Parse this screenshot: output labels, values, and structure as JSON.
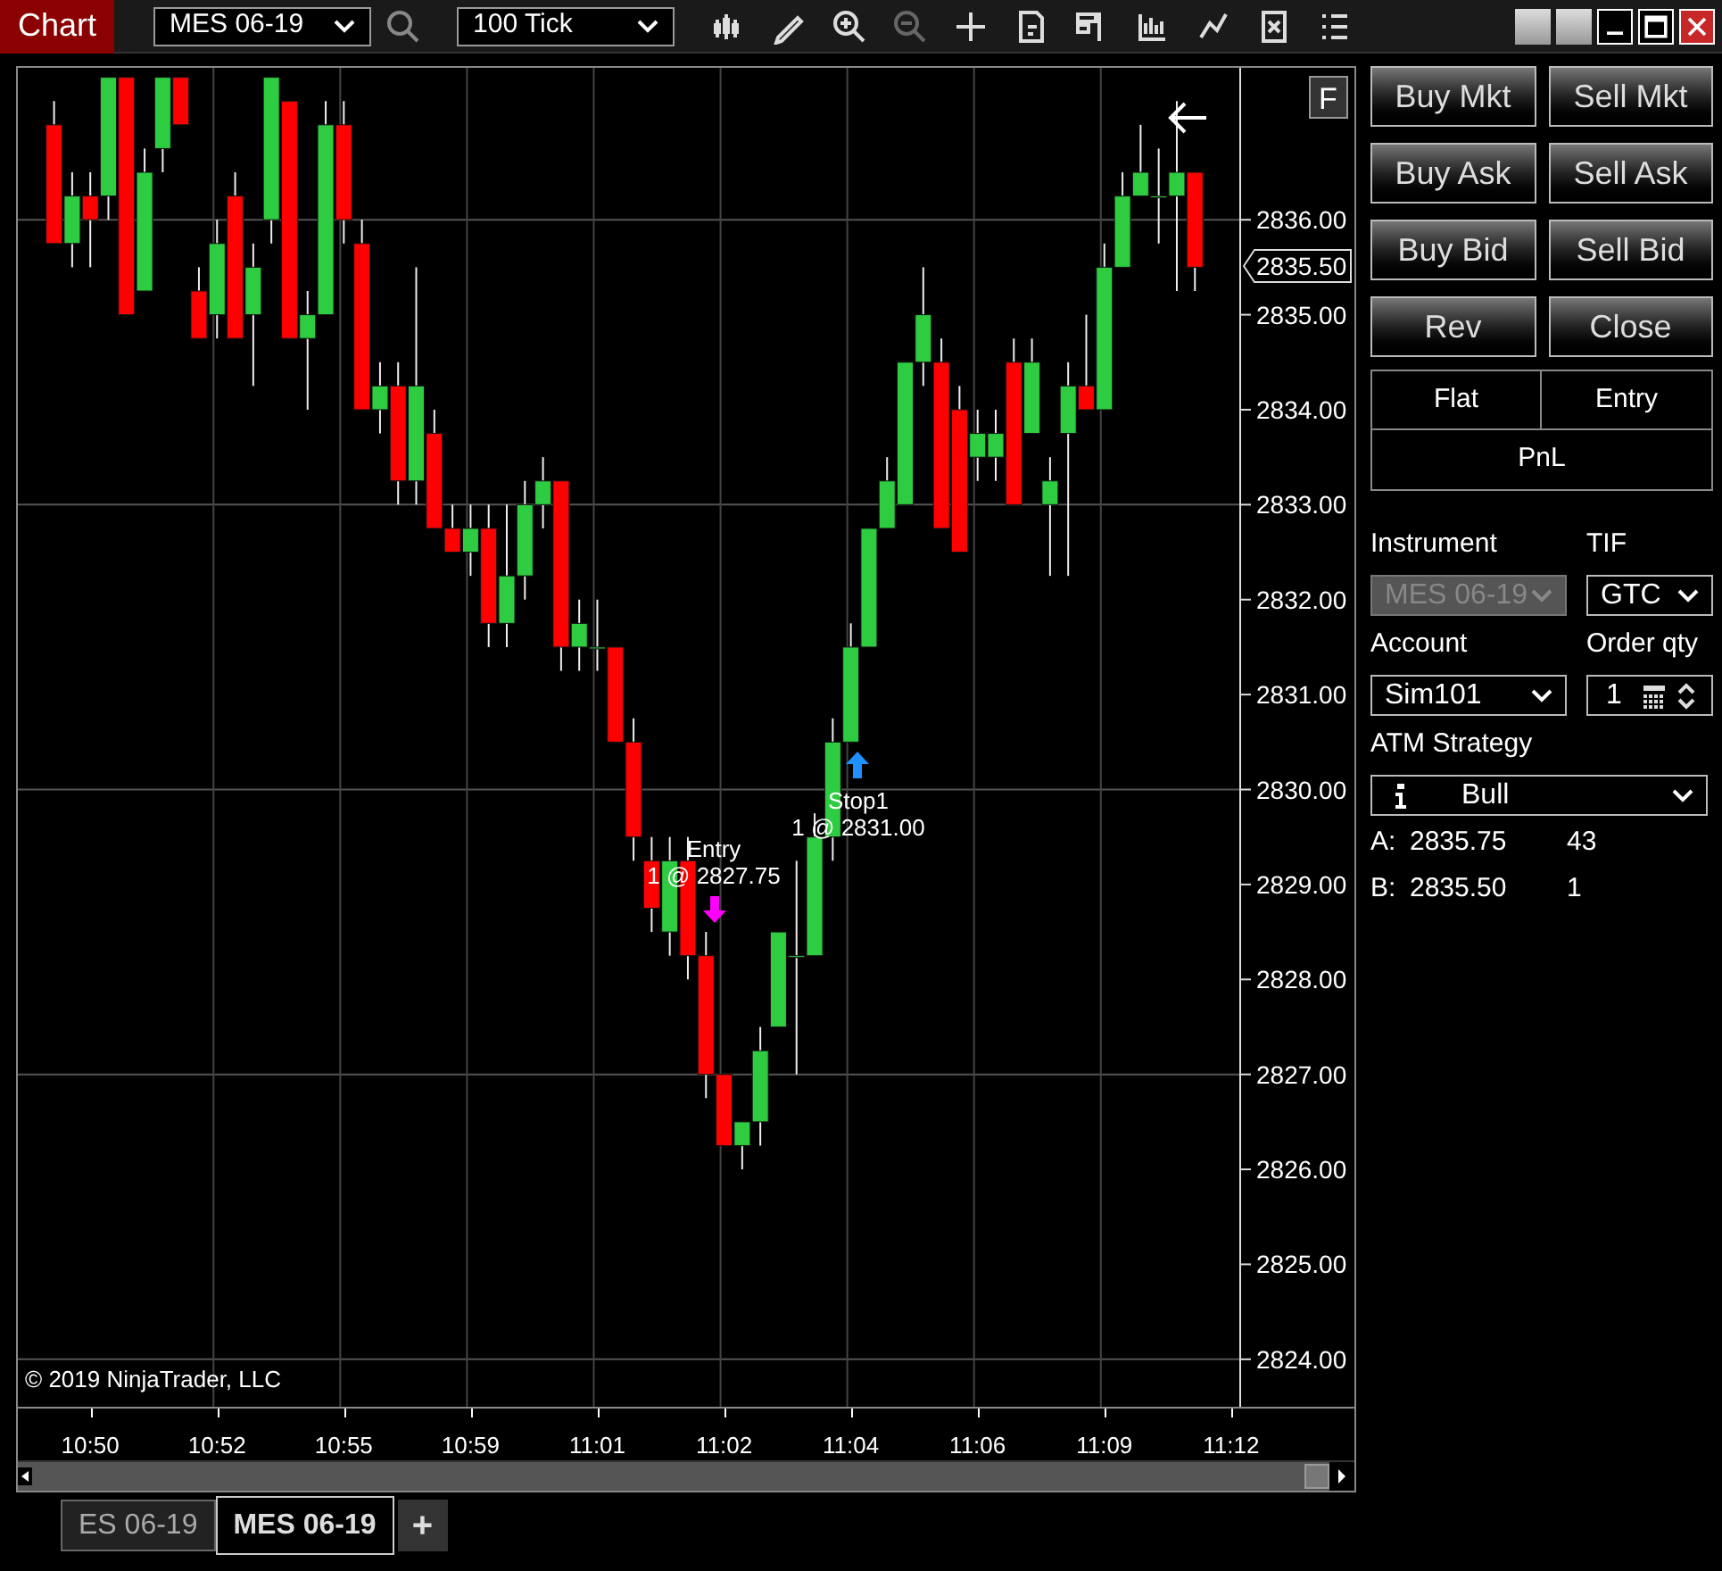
{
  "window": {
    "title": "Chart",
    "instrument": "MES 06-19",
    "interval": "100 Tick"
  },
  "chart": {
    "chart_data": {
      "type": "candlestick",
      "grid": true,
      "ylim": [
        2823.5,
        2837.6
      ],
      "categories": [
        null,
        null,
        "10:50",
        null,
        null,
        null,
        null,
        null,
        null,
        "10:52",
        null,
        null,
        null,
        null,
        null,
        null,
        "10:55",
        null,
        null,
        null,
        null,
        null,
        null,
        "10:59",
        null,
        null,
        null,
        null,
        null,
        null,
        "11:01",
        null,
        null,
        null,
        null,
        null,
        null,
        "11:02",
        null,
        null,
        null,
        null,
        null,
        null,
        "11:04",
        null,
        null,
        null,
        null,
        null,
        null,
        "11:06",
        null,
        null,
        null,
        null,
        null,
        null,
        "11:09",
        null,
        null,
        null,
        null,
        null
      ],
      "ohlc": [
        [
          2837.0,
          2837.25,
          2835.75,
          2835.75
        ],
        [
          2835.75,
          2836.5,
          2835.5,
          2836.25
        ],
        [
          2836.25,
          2836.5,
          2835.5,
          2836.0
        ],
        [
          2836.25,
          2837.5,
          2836.0,
          2837.5
        ],
        [
          2837.5,
          2837.5,
          2835.0,
          2835.0
        ],
        [
          2835.25,
          2836.75,
          2835.25,
          2836.5
        ],
        [
          2836.75,
          2837.5,
          2836.5,
          2837.5
        ],
        [
          2837.5,
          2837.5,
          2837.0,
          2837.0
        ],
        [
          2835.25,
          2835.5,
          2834.75,
          2834.75
        ],
        [
          2835.0,
          2836.0,
          2834.75,
          2835.75
        ],
        [
          2836.25,
          2836.5,
          2834.75,
          2834.75
        ],
        [
          2835.0,
          2835.75,
          2834.25,
          2835.5
        ],
        [
          2836.0,
          2837.5,
          2835.75,
          2837.5
        ],
        [
          2837.25,
          2837.25,
          2834.75,
          2834.75
        ],
        [
          2834.75,
          2835.25,
          2834.0,
          2835.0
        ],
        [
          2835.0,
          2837.25,
          2835.0,
          2837.0
        ],
        [
          2837.0,
          2837.25,
          2835.75,
          2836.0
        ],
        [
          2835.75,
          2836.0,
          2834.0,
          2834.0
        ],
        [
          2834.0,
          2834.5,
          2833.75,
          2834.25
        ],
        [
          2834.25,
          2834.5,
          2833.0,
          2833.25
        ],
        [
          2833.25,
          2835.5,
          2833.0,
          2834.25
        ],
        [
          2833.75,
          2834.0,
          2832.75,
          2832.75
        ],
        [
          2832.75,
          2833.0,
          2832.5,
          2832.5
        ],
        [
          2832.5,
          2833.0,
          2832.25,
          2832.75
        ],
        [
          2832.75,
          2833.0,
          2831.5,
          2831.75
        ],
        [
          2831.75,
          2833.0,
          2831.5,
          2832.25
        ],
        [
          2832.25,
          2833.25,
          2832.0,
          2833.0
        ],
        [
          2833.0,
          2833.5,
          2832.75,
          2833.25
        ],
        [
          2833.25,
          2833.25,
          2831.25,
          2831.5
        ],
        [
          2831.5,
          2832.0,
          2831.25,
          2831.75
        ],
        [
          2831.5,
          2832.0,
          2831.25,
          2831.5
        ],
        [
          2831.5,
          2831.5,
          2830.5,
          2830.5
        ],
        [
          2830.5,
          2830.75,
          2829.25,
          2829.5
        ],
        [
          2829.25,
          2829.5,
          2828.5,
          2828.75
        ],
        [
          2828.5,
          2829.5,
          2828.25,
          2829.25
        ],
        [
          2829.25,
          2829.5,
          2828.0,
          2828.25
        ],
        [
          2828.25,
          2828.5,
          2826.75,
          2827.0
        ],
        [
          2827.0,
          2827.0,
          2826.25,
          2826.25
        ],
        [
          2826.25,
          2826.5,
          2826.0,
          2826.5
        ],
        [
          2826.5,
          2827.5,
          2826.25,
          2827.25
        ],
        [
          2827.5,
          2828.5,
          2827.5,
          2828.5
        ],
        [
          2828.25,
          2829.25,
          2827.0,
          2828.25
        ],
        [
          2828.25,
          2829.75,
          2828.25,
          2829.5
        ],
        [
          2829.5,
          2830.75,
          2829.25,
          2830.5
        ],
        [
          2830.5,
          2831.75,
          2830.5,
          2831.5
        ],
        [
          2831.5,
          2832.75,
          2831.5,
          2832.75
        ],
        [
          2832.75,
          2833.5,
          2832.75,
          2833.25
        ],
        [
          2833.0,
          2834.5,
          2833.0,
          2834.5
        ],
        [
          2834.5,
          2835.5,
          2834.25,
          2835.0
        ],
        [
          2834.5,
          2834.75,
          2832.75,
          2832.75
        ],
        [
          2834.0,
          2834.25,
          2832.5,
          2832.5
        ],
        [
          2833.5,
          2834.0,
          2833.25,
          2833.75
        ],
        [
          2833.5,
          2834.0,
          2833.25,
          2833.75
        ],
        [
          2834.5,
          2834.75,
          2833.0,
          2833.0
        ],
        [
          2833.75,
          2834.75,
          2833.75,
          2834.5
        ],
        [
          2833.0,
          2833.5,
          2832.25,
          2833.25
        ],
        [
          2833.75,
          2834.5,
          2832.25,
          2834.25
        ],
        [
          2834.25,
          2835.0,
          2834.0,
          2834.0
        ],
        [
          2834.0,
          2835.75,
          2834.0,
          2835.5
        ],
        [
          2835.5,
          2836.5,
          2835.5,
          2836.25
        ],
        [
          2836.25,
          2837.0,
          2836.25,
          2836.5
        ],
        [
          2836.25,
          2836.75,
          2835.75,
          2836.25
        ],
        [
          2836.25,
          2837.25,
          2835.25,
          2836.5
        ],
        [
          2836.5,
          2836.5,
          2835.25,
          2835.5
        ]
      ],
      "yticks": [
        {
          "value": 2836,
          "label": "2836.00"
        },
        {
          "value": 2835,
          "label": "2835.00"
        },
        {
          "value": 2834,
          "label": "2834.00"
        },
        {
          "value": 2833,
          "label": "2833.00"
        },
        {
          "value": 2832,
          "label": "2832.00"
        },
        {
          "value": 2831,
          "label": "2831.00"
        },
        {
          "value": 2830,
          "label": "2830.00"
        },
        {
          "value": 2829,
          "label": "2829.00"
        },
        {
          "value": 2828,
          "label": "2828.00"
        },
        {
          "value": 2827,
          "label": "2827.00"
        },
        {
          "value": 2826,
          "label": "2826.00"
        },
        {
          "value": 2825,
          "label": "2825.00"
        },
        {
          "value": 2824,
          "label": "2824.00"
        }
      ]
    },
    "last_time_label": "11:12",
    "last_price": "2835.50",
    "f_button": "F",
    "copyright": "© 2019 NinjaTrader, LLC",
    "orders": [
      {
        "name": "Entry",
        "detail": "1 @ 2827.75"
      },
      {
        "name": "Stop1",
        "detail": "1 @ 2831.00"
      }
    ]
  },
  "tabs": [
    {
      "label": "ES 06-19",
      "selected": false
    },
    {
      "label": "MES 06-19",
      "selected": true
    }
  ],
  "add_tab": "+",
  "panel": {
    "buttons": [
      "Buy Mkt",
      "Sell Mkt",
      "Buy Ask",
      "Sell Ask",
      "Buy Bid",
      "Sell Bid",
      "Rev",
      "Close"
    ],
    "position": {
      "flat": "Flat",
      "entry": "Entry",
      "pnl": "PnL"
    },
    "instrument": {
      "label": "Instrument",
      "value": "MES 06-19",
      "disabled": true
    },
    "tif": {
      "label": "TIF",
      "value": "GTC"
    },
    "account": {
      "label": "Account",
      "value": "Sim101"
    },
    "order_qty": {
      "label": "Order qty",
      "value": "1"
    },
    "atm": {
      "label": "ATM Strategy",
      "value": "Bull"
    },
    "quotes": [
      {
        "side": "A:",
        "price": "2835.75",
        "size": "43"
      },
      {
        "side": "B:",
        "price": "2835.50",
        "size": "1"
      }
    ]
  }
}
